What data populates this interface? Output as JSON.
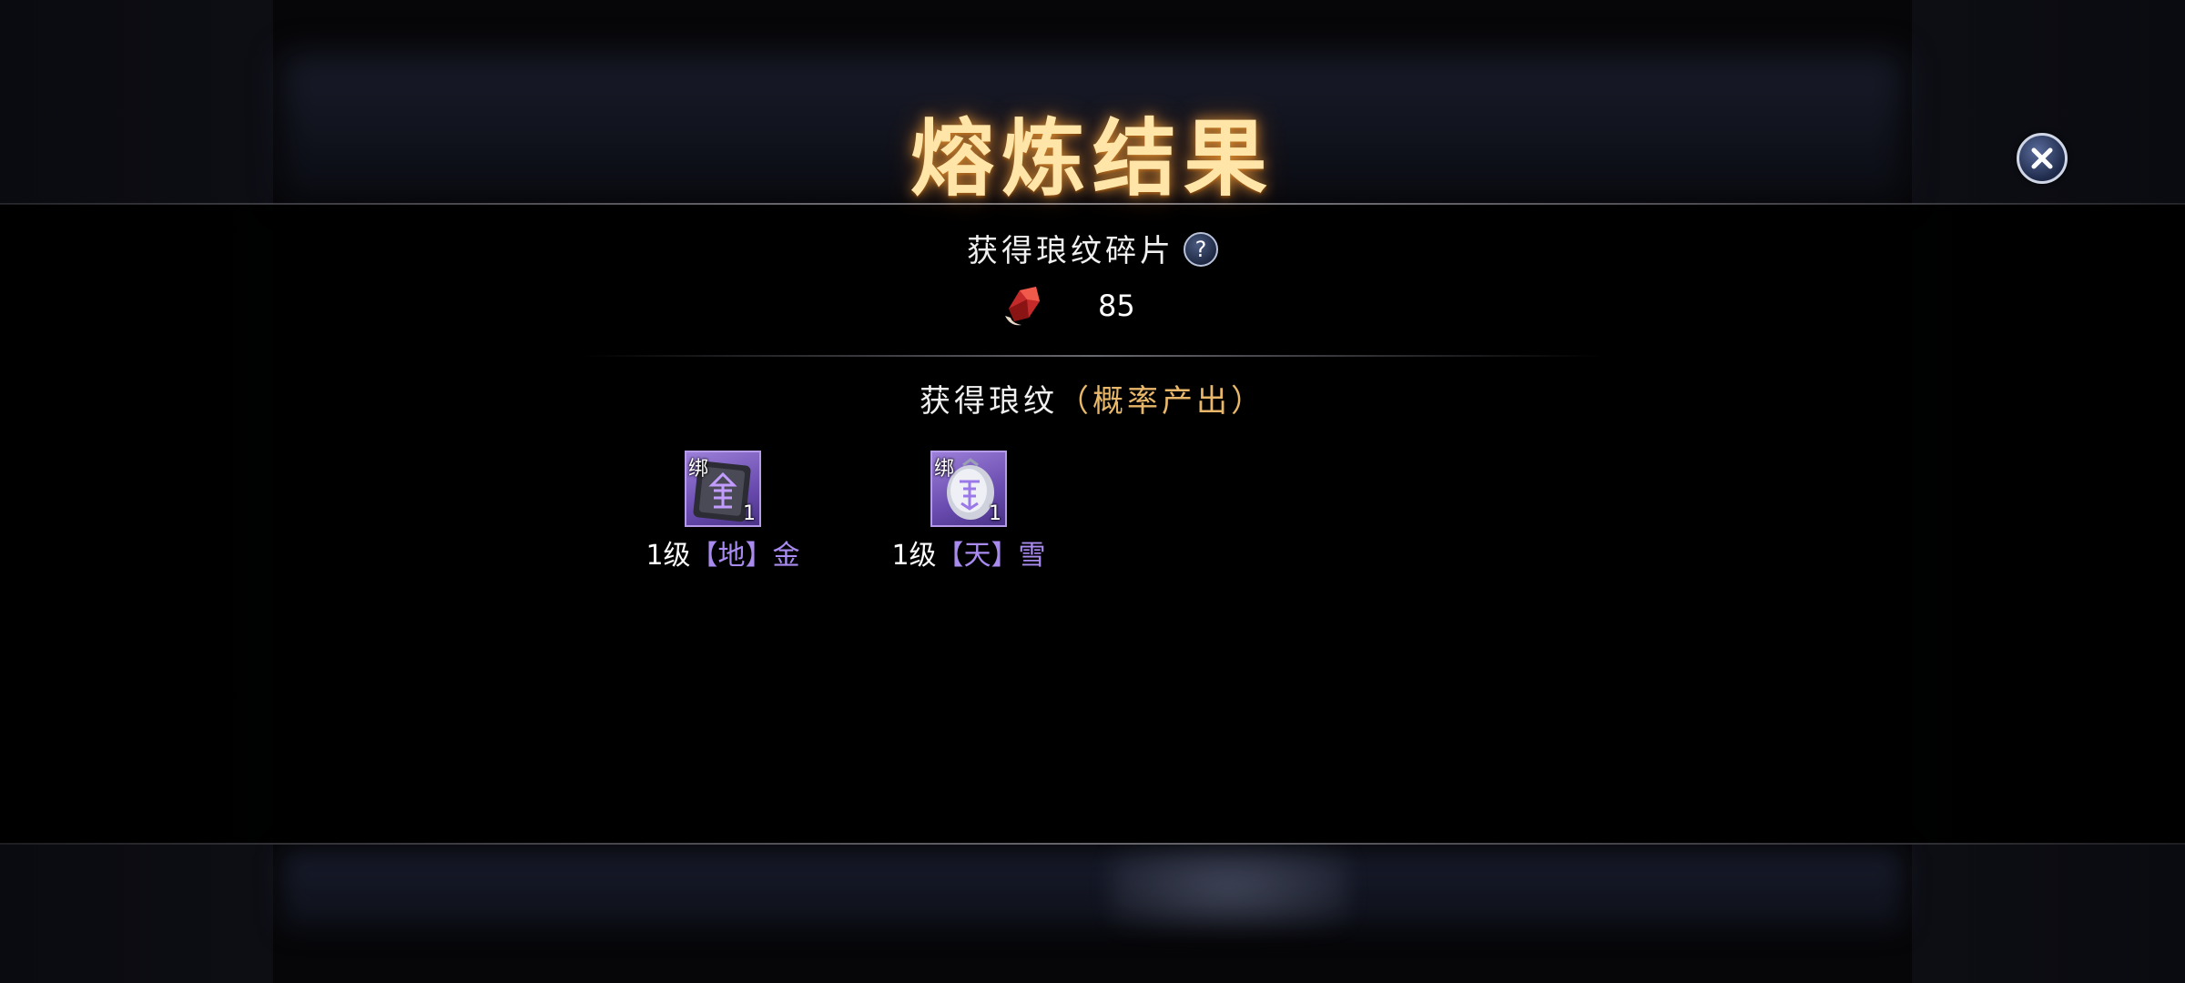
{
  "title": "熔炼结果",
  "fragments": {
    "heading": "获得琅纹碎片",
    "help_label": "?",
    "count": "85",
    "icon": "red-fragment-icon"
  },
  "drops": {
    "heading": "获得琅纹",
    "note": "（概率产出）",
    "items": [
      {
        "bind_tag": "绑",
        "quantity": "1",
        "level": "1级",
        "grade": "【地】",
        "name": "金",
        "icon": "jin-rune-icon"
      },
      {
        "bind_tag": "绑",
        "quantity": "1",
        "level": "1级",
        "grade": "【天】",
        "name": "雪",
        "icon": "xue-rune-icon"
      }
    ]
  },
  "colors": {
    "title": "#ffe6a8",
    "note": "#e8b76a",
    "grade": "#a98bf0",
    "item_frame": "#7a5cc4"
  }
}
